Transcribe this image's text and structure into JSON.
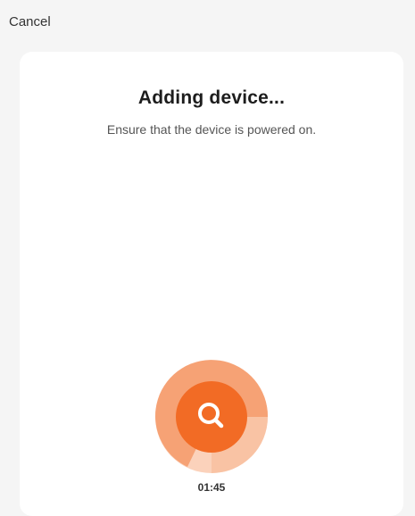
{
  "header": {
    "cancel_label": "Cancel"
  },
  "main": {
    "title": "Adding device...",
    "subtitle": "Ensure that the device is powered on.",
    "timer": "01:45",
    "scan_icon": "search-icon"
  },
  "colors": {
    "accent": "#f26b25",
    "accent_mid": "#f6a275",
    "accent_light": "#fbd2bb",
    "background": "#f5f5f5",
    "card": "#ffffff"
  }
}
